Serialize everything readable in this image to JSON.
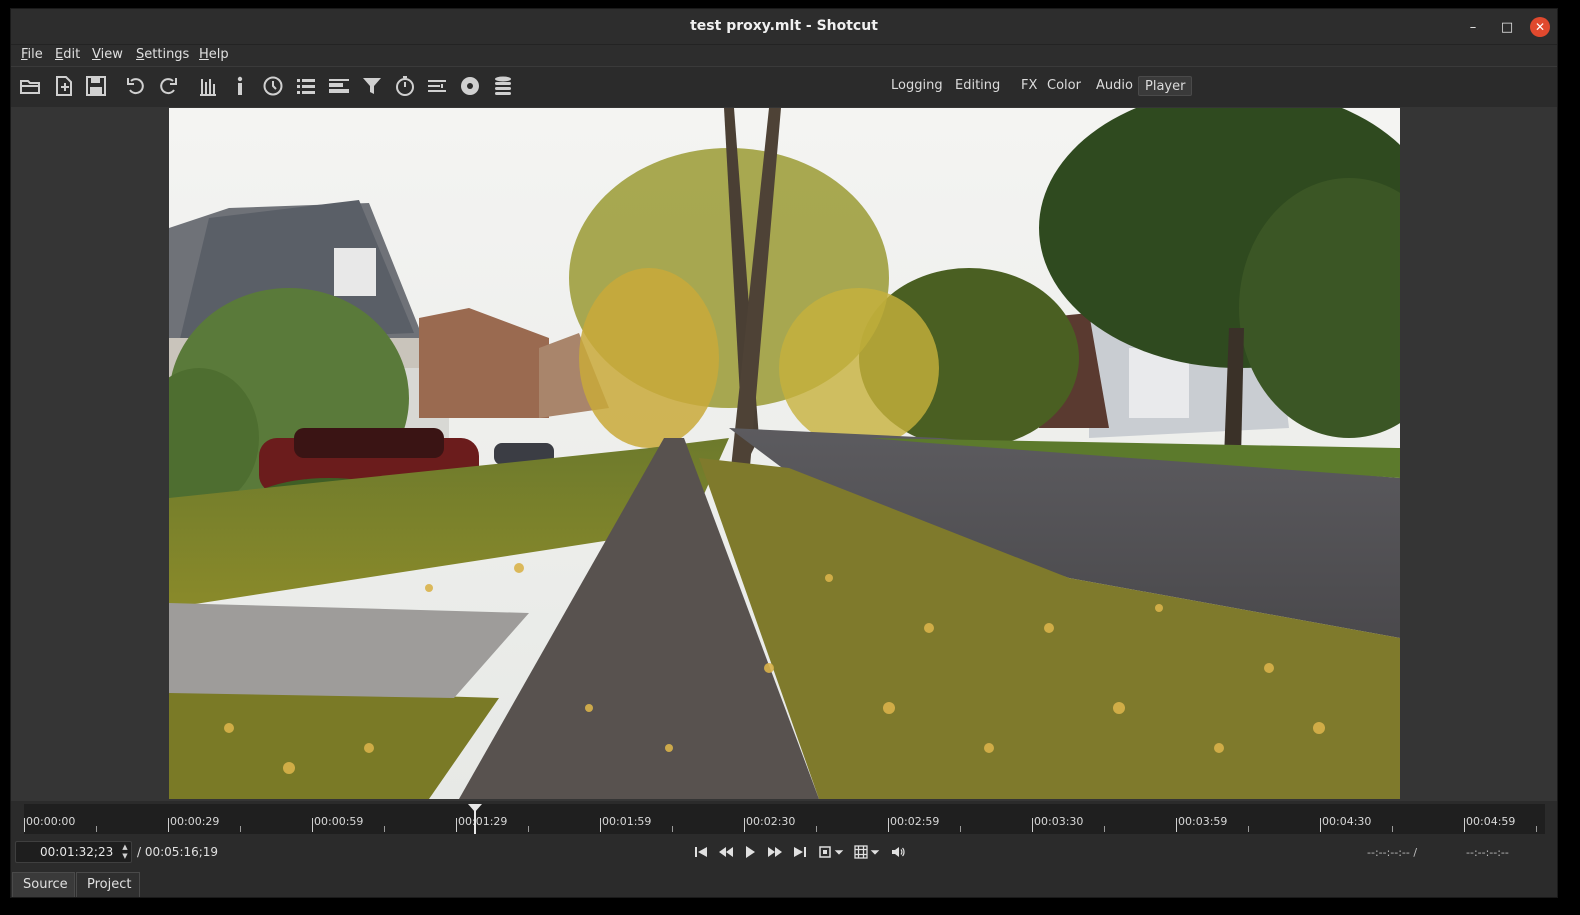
{
  "window": {
    "title": "test proxy.mlt - Shotcut",
    "minimize_glyph": "–",
    "maximize_glyph": "□",
    "close_glyph": "✕"
  },
  "menu": [
    "File",
    "Edit",
    "View",
    "Settings",
    "Help"
  ],
  "toolbar": {
    "icons": [
      "open-file-icon",
      "open-other-icon",
      "save-icon",
      "undo-icon",
      "redo-icon",
      "peak-meter-icon",
      "properties-icon",
      "recent-icon",
      "playlist-icon",
      "timeline-icon",
      "filters-icon",
      "keyframes-icon",
      "history-icon",
      "export-icon",
      "jobs-icon"
    ],
    "layouts": [
      "Logging",
      "Editing",
      "FX",
      "Color",
      "Audio",
      "Player"
    ],
    "active_layout": "Player"
  },
  "ruler": {
    "labels": [
      "00:00:00",
      "00:00:29",
      "00:00:59",
      "00:01:29",
      "00:01:59",
      "00:02:30",
      "00:02:59",
      "00:03:30",
      "00:03:59",
      "00:04:30",
      "00:04:59"
    ]
  },
  "transport": {
    "position": "00:01:32;23",
    "duration": "/ 00:05:16;19",
    "in_point": "--:--:--:-- /",
    "out_point": "--:--:--:--",
    "spin_up": "▲",
    "spin_down": "▼"
  },
  "tabs": {
    "source": "Source",
    "project": "Project",
    "active": "Source"
  },
  "colors": {
    "window_bg": "#2b2b2b",
    "viewer_bg": "#353535",
    "close_button": "#e0492e"
  }
}
